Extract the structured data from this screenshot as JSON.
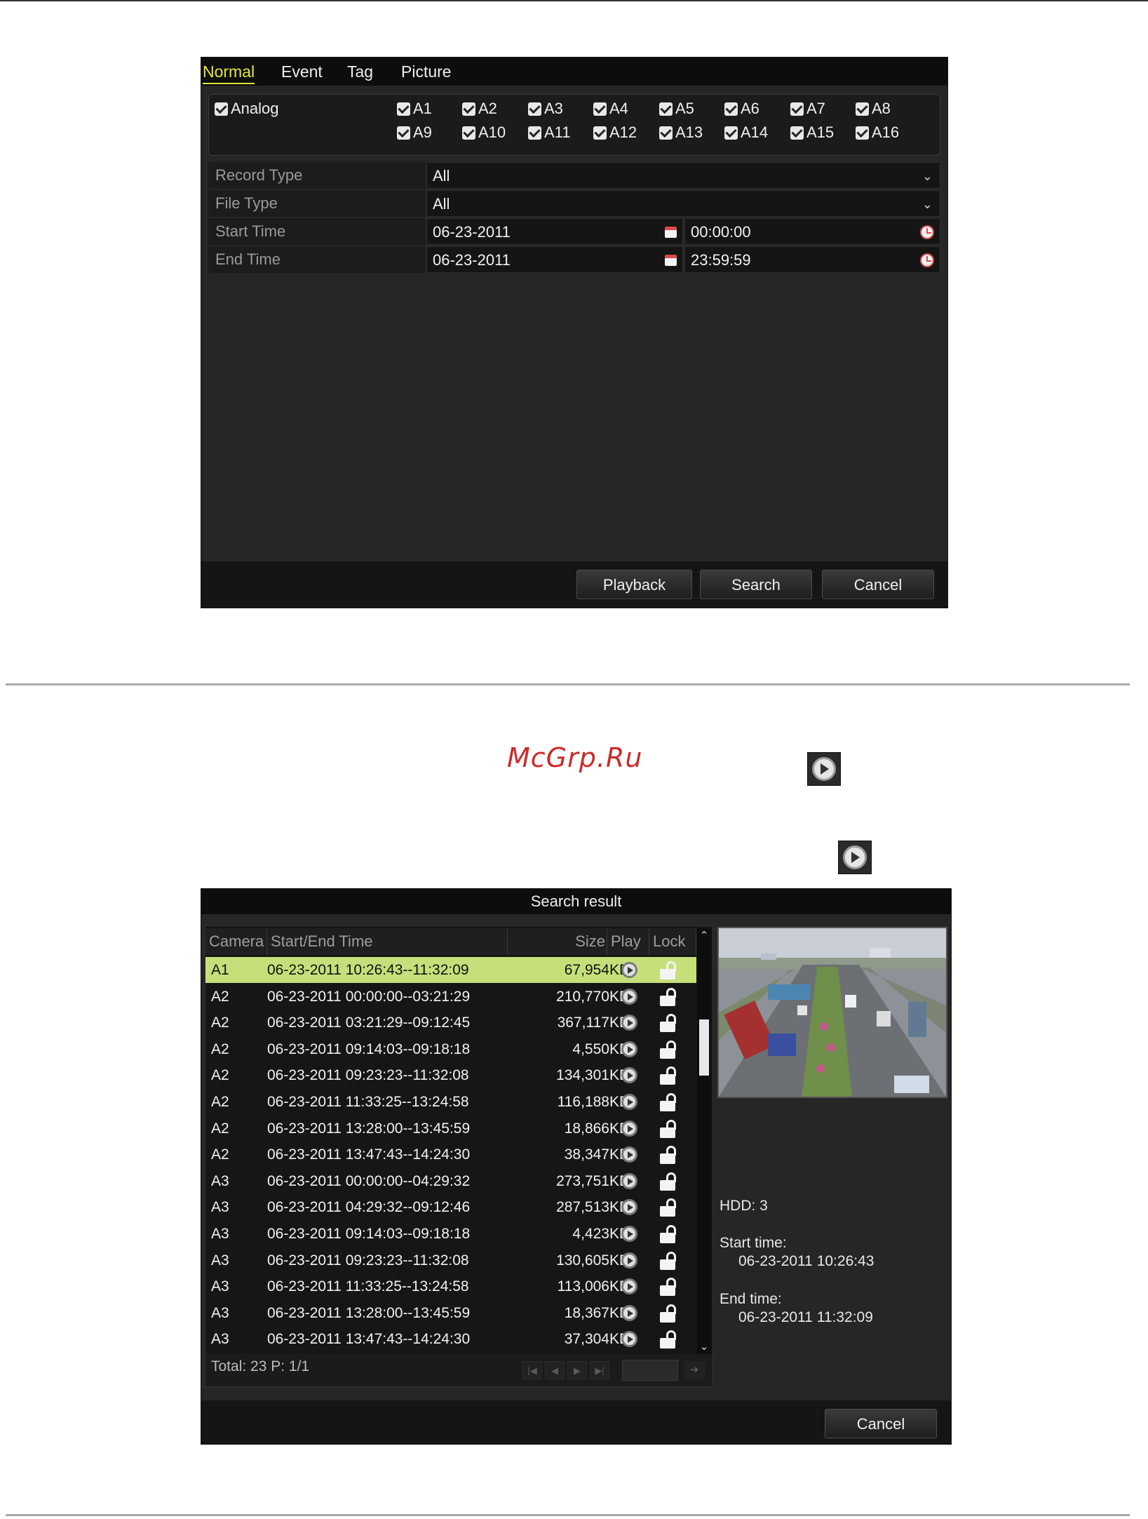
{
  "search": {
    "tabs": [
      "Normal",
      "Event",
      "Tag",
      "Picture"
    ],
    "analog_label": "Analog",
    "cameras": [
      "A1",
      "A2",
      "A3",
      "A4",
      "A5",
      "A6",
      "A7",
      "A8",
      "A9",
      "A10",
      "A11",
      "A12",
      "A13",
      "A14",
      "A15",
      "A16"
    ],
    "record_type": {
      "label": "Record Type",
      "value": "All"
    },
    "file_type": {
      "label": "File Type",
      "value": "All"
    },
    "start_time": {
      "label": "Start Time",
      "date": "06-23-2011",
      "time": "00:00:00"
    },
    "end_time": {
      "label": "End Time",
      "date": "06-23-2011",
      "time": "23:59:59"
    },
    "buttons": {
      "playback": "Playback",
      "search": "Search",
      "cancel": "Cancel"
    }
  },
  "watermark": "McGrp.Ru",
  "result": {
    "title": "Search result",
    "columns": {
      "camera": "Camera",
      "time": "Start/End Time",
      "size": "Size",
      "play": "Play",
      "lock": "Lock"
    },
    "rows": [
      {
        "camera": "A1",
        "time": "06-23-2011 10:26:43--11:32:09",
        "size": "67,954KB"
      },
      {
        "camera": "A2",
        "time": "06-23-2011 00:00:00--03:21:29",
        "size": "210,770KB"
      },
      {
        "camera": "A2",
        "time": "06-23-2011 03:21:29--09:12:45",
        "size": "367,117KB"
      },
      {
        "camera": "A2",
        "time": "06-23-2011 09:14:03--09:18:18",
        "size": "4,550KB"
      },
      {
        "camera": "A2",
        "time": "06-23-2011 09:23:23--11:32:08",
        "size": "134,301KB"
      },
      {
        "camera": "A2",
        "time": "06-23-2011 11:33:25--13:24:58",
        "size": "116,188KB"
      },
      {
        "camera": "A2",
        "time": "06-23-2011 13:28:00--13:45:59",
        "size": "18,866KB"
      },
      {
        "camera": "A2",
        "time": "06-23-2011 13:47:43--14:24:30",
        "size": "38,347KB"
      },
      {
        "camera": "A3",
        "time": "06-23-2011 00:00:00--04:29:32",
        "size": "273,751KB"
      },
      {
        "camera": "A3",
        "time": "06-23-2011 04:29:32--09:12:46",
        "size": "287,513KB"
      },
      {
        "camera": "A3",
        "time": "06-23-2011 09:14:03--09:18:18",
        "size": "4,423KB"
      },
      {
        "camera": "A3",
        "time": "06-23-2011 09:23:23--11:32:08",
        "size": "130,605KB"
      },
      {
        "camera": "A3",
        "time": "06-23-2011 11:33:25--13:24:58",
        "size": "113,006KB"
      },
      {
        "camera": "A3",
        "time": "06-23-2011 13:28:00--13:45:59",
        "size": "18,367KB"
      },
      {
        "camera": "A3",
        "time": "06-23-2011 13:47:43--14:24:30",
        "size": "37,304KB"
      }
    ],
    "total": "Total: 23  P: 1/1",
    "hdd": "HDD: 3",
    "start_label": "Start time:",
    "start_value": "06-23-2011 10:26:43",
    "end_label": "End time:",
    "end_value": "06-23-2011 11:32:09",
    "cancel": "Cancel"
  }
}
